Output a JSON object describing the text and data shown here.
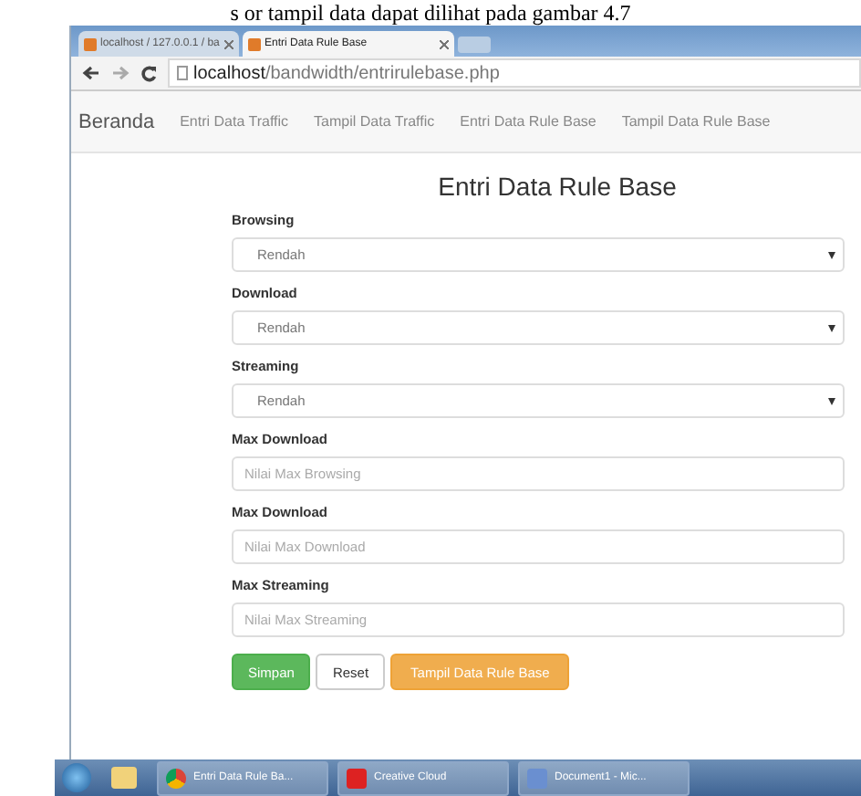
{
  "document_text": "s or tampil data dapat dilihat pada gambar 4.7",
  "browser": {
    "tabs": [
      {
        "title": "localhost / 127.0.0.1 / ba",
        "selected": false
      },
      {
        "title": "Entri Data Rule Base",
        "selected": true
      }
    ],
    "address": {
      "host": "localhost",
      "path": "/bandwidth/entrirulebase.php"
    }
  },
  "navbar": {
    "brand": "Beranda",
    "items": [
      "Entri Data Traffic",
      "Tampil Data Traffic",
      "Entri Data Rule Base",
      "Tampil Data Rule Base"
    ]
  },
  "page_title": "Entri Data Rule Base",
  "fields": [
    {
      "kind": "select",
      "label": "Browsing",
      "value": "Rendah"
    },
    {
      "kind": "select",
      "label": "Download",
      "value": "Rendah"
    },
    {
      "kind": "select",
      "label": "Streaming",
      "value": "Rendah"
    },
    {
      "kind": "text",
      "label": "Max Download",
      "placeholder": "Nilai Max Browsing"
    },
    {
      "kind": "text",
      "label": "Max Download",
      "placeholder": "Nilai Max Download"
    },
    {
      "kind": "text",
      "label": "Max Streaming",
      "placeholder": "Nilai Max Streaming"
    }
  ],
  "buttons": [
    {
      "kind": "success",
      "label": "Simpan"
    },
    {
      "kind": "default",
      "label": "Reset"
    },
    {
      "kind": "warning",
      "label": "Tampil Data Rule Base"
    }
  ],
  "taskbar": {
    "windows": [
      {
        "kind": "chrome",
        "title": "Entri Data Rule Ba..."
      },
      {
        "kind": "cloud",
        "title": "Creative Cloud"
      },
      {
        "kind": "word",
        "title": "Document1 - Mic..."
      }
    ]
  }
}
